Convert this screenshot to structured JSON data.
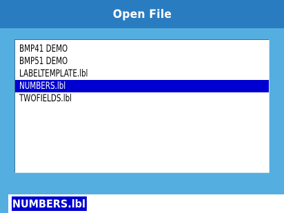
{
  "dialog": {
    "title": "Open File"
  },
  "file_list": {
    "items": [
      {
        "label": "BMP41 DEMO",
        "selected": false
      },
      {
        "label": "BMP51 DEMO",
        "selected": false
      },
      {
        "label": "LABELTEMPLATE.lbl",
        "selected": false
      },
      {
        "label": "NUMBERS.lbl",
        "selected": true
      },
      {
        "label": "TWOFIELDS.lbl",
        "selected": false
      }
    ]
  },
  "filename_field": {
    "value": "NUMBERS.lbl"
  },
  "colors": {
    "dialog_background": "#55aee0",
    "title_bar": "#2a7cc1",
    "selection": "#0000d0"
  }
}
